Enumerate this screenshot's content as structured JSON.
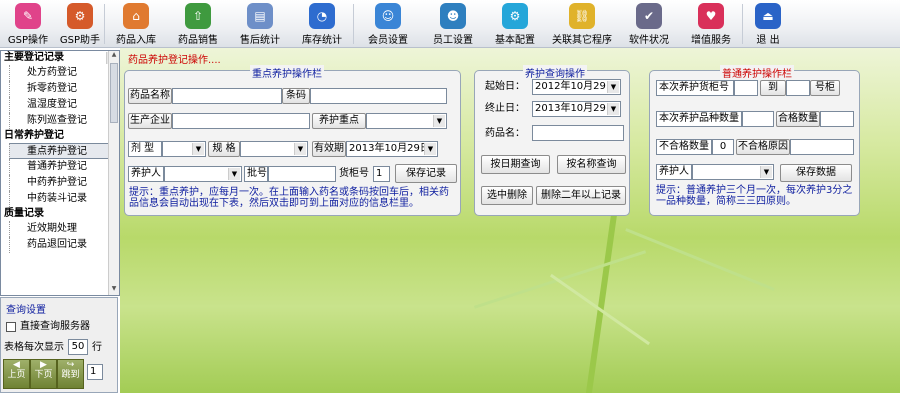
{
  "toolbar": [
    {
      "label": "GSP操作",
      "icon": "notepad-icon",
      "color": "#e0438a"
    },
    {
      "label": "GSP助手",
      "icon": "gsp-helper-icon",
      "color": "#d55a2a"
    },
    {
      "label": "药品入库",
      "icon": "warehouse-icon",
      "color": "#e07a30"
    },
    {
      "label": "药品销售",
      "icon": "sales-icon",
      "color": "#3f9a3f"
    },
    {
      "label": "售后统计",
      "icon": "clipboard-icon",
      "color": "#6e8fc8"
    },
    {
      "label": "库存统计",
      "icon": "pie-chart-icon",
      "color": "#2e6ccf"
    },
    {
      "label": "会员设置",
      "icon": "members-icon",
      "color": "#3a85d6"
    },
    {
      "label": "员工设置",
      "icon": "staff-icon",
      "color": "#2e7fbf"
    },
    {
      "label": "基本配置",
      "icon": "gear-icon",
      "color": "#25a6d9"
    },
    {
      "label": "关联其它程序",
      "icon": "link-program-icon",
      "color": "#e0b22a"
    },
    {
      "label": "软件状况",
      "icon": "software-status-icon",
      "color": "#6a6a8a"
    },
    {
      "label": "增值服务",
      "icon": "heart-icon",
      "color": "#d9305a"
    },
    {
      "label": "退 出",
      "icon": "exit-icon",
      "color": "#2a63c7"
    }
  ],
  "breadcrumb": "药品养护登记操作....",
  "sidebar": {
    "sections": [
      {
        "title": "主要登记记录",
        "items": [
          "处方药登记",
          "拆零药登记",
          "温湿度登记",
          "陈列巡查登记"
        ]
      },
      {
        "title": "日常养护登记",
        "items": [
          "重点养护登记",
          "普通养护登记",
          "中药养护登记",
          "中药装斗记录"
        ]
      },
      {
        "title": "质量记录",
        "items": [
          "近效期处理",
          "药品退回记录"
        ]
      }
    ],
    "selected": "重点养护登记"
  },
  "key": {
    "title": "重点养护操作栏",
    "drug_name": "药品名称",
    "barcode": "条码",
    "manufacturer": "生产企业",
    "key_care": "养护重点",
    "dosage_form": "剂 型",
    "spec": "规 格",
    "expiry": "有效期",
    "expiry_date": "2013年10月29日",
    "caretaker": "养护人",
    "batch": "批号",
    "shelf_no": "货柜号",
    "shelf_value": "1",
    "save": "保存记录",
    "hint": "提示：重点养护，应每月一次。在上面输入药名或条码按回车后，相关药品信息会自动出现在下表，然后双击即可到上面对应的信息栏里。"
  },
  "query": {
    "title": "养护查询操作",
    "start_label": "起始日：",
    "start_date": "2012年10月29日",
    "end_label": "终止日：",
    "end_date": "2013年10月29日",
    "name_label": "药品名：",
    "by_date": "按日期查询",
    "by_name": "按名称查询",
    "delete_selected": "选中删除",
    "delete_two_years": "删除二年以上记录"
  },
  "normal": {
    "title": "普通养护操作栏",
    "shelf_label": "本次养护货柜号",
    "to": "到",
    "shelf_suffix": "号柜",
    "variety_label": "本次养护品种数量",
    "qualified": "合格数量",
    "unqualified": "不合格数量",
    "unqualified_value": "0",
    "reason": "不合格原因",
    "caretaker": "养护人",
    "save": "保存数据",
    "hint": "提示：普通养护三个月一次，每次养护3分之一品种数量，简称三三四原则。"
  },
  "query_settings": {
    "title": "查询设置",
    "direct_query": "直接查询服务器",
    "rows_label": "表格每次显示",
    "rows_value": "50",
    "rows_unit": "行",
    "prev": "上页",
    "next": "下页",
    "jump": "跳到",
    "page_value": "1"
  }
}
